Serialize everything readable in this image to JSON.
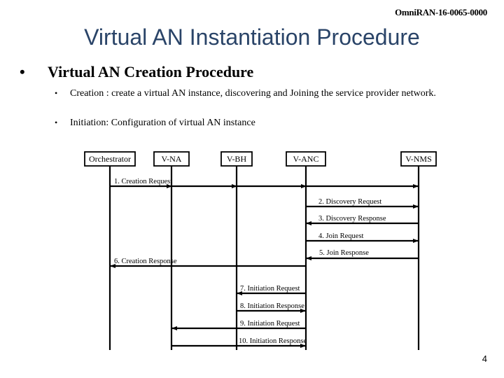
{
  "header": {
    "doc_id": "OmniRAN-16-0065-0000"
  },
  "slide": {
    "title": "Virtual AN Instantiation Procedure",
    "bullet": "Virtual AN Creation Procedure",
    "sub_bullets": [
      "Creation : create a virtual AN instance, discovering and Joining the service provider network.",
      "Initiation: Configuration of virtual AN instance"
    ],
    "page_number": "4"
  },
  "diagram": {
    "entities": [
      "Orchestrator",
      "V-NA",
      "V-BH",
      "V-ANC",
      "V-NMS"
    ],
    "messages": [
      {
        "label": "1.  Creation Request",
        "from": "Orchestrator",
        "to": "V-NMS",
        "via": [
          "V-NA",
          "V-BH",
          "V-ANC"
        ]
      },
      {
        "label": "2.  Discovery Request",
        "from": "V-ANC",
        "to": "V-NMS"
      },
      {
        "label": "3.  Discovery Response",
        "from": "V-NMS",
        "to": "V-ANC"
      },
      {
        "label": "4.  Join Request",
        "from": "V-ANC",
        "to": "V-NMS"
      },
      {
        "label": "5. Join Response",
        "from": "V-NMS",
        "to": "V-ANC"
      },
      {
        "label": "6.  Creation Response",
        "from": "V-ANC",
        "to": "Orchestrator"
      },
      {
        "label": "7.  Initiation  Request",
        "from": "V-ANC",
        "to": "V-BH"
      },
      {
        "label": "8.  Initiation Response",
        "from": "V-BH",
        "to": "V-ANC"
      },
      {
        "label": "9.  Initiation  Request",
        "from": "V-ANC",
        "to": "V-NA"
      },
      {
        "label": "10.  Initiation Response",
        "from": "V-NA",
        "to": "V-ANC"
      }
    ]
  }
}
